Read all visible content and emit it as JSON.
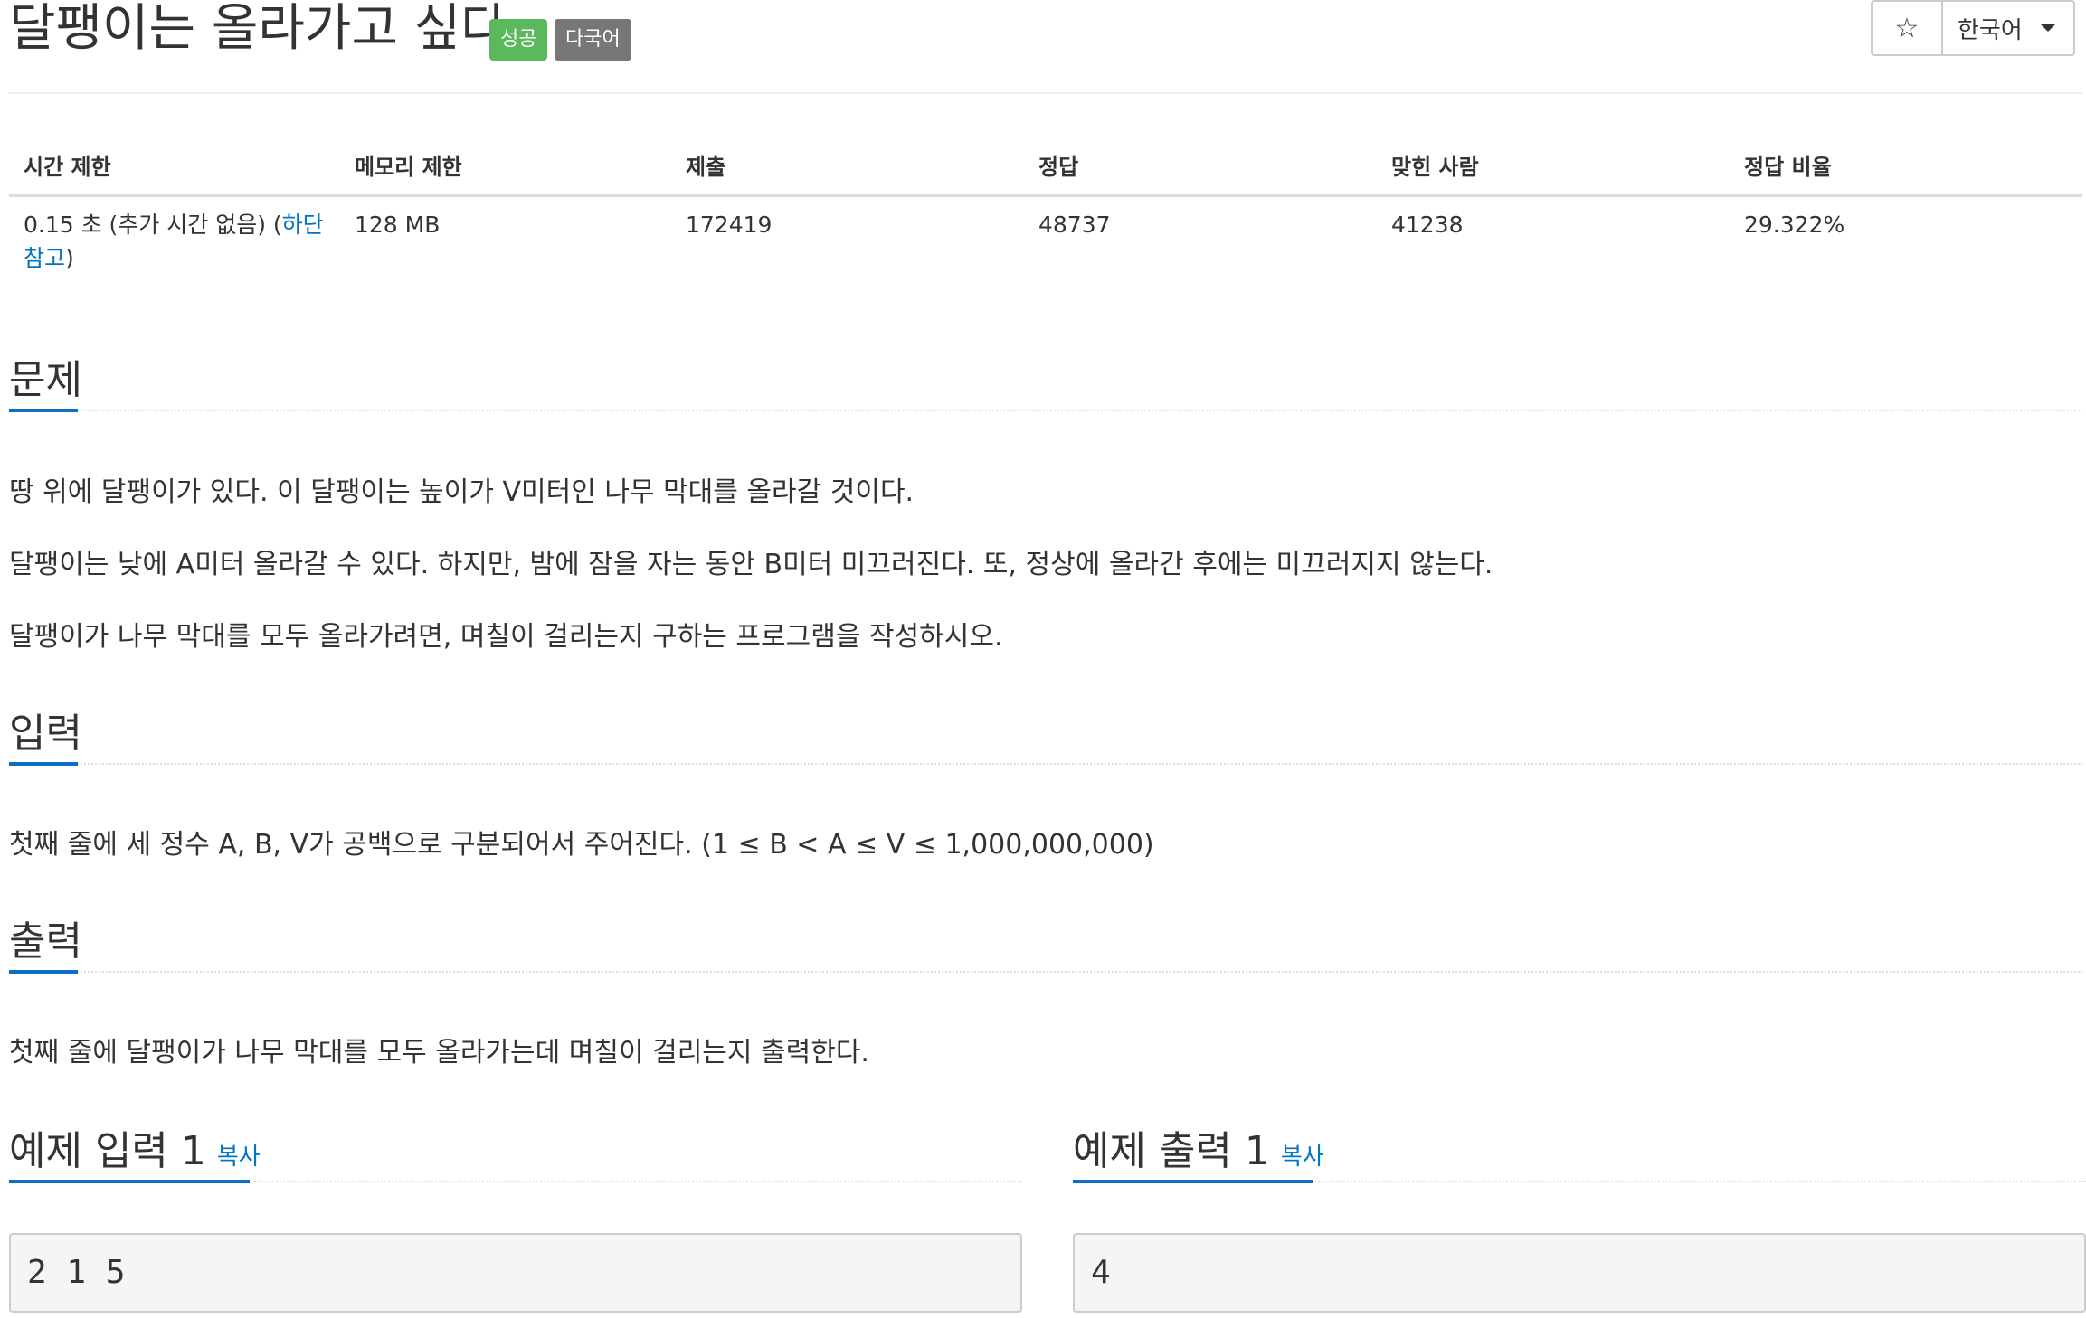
{
  "header": {
    "title": "달팽이는 올라가고 싶다",
    "success_label": "성공",
    "multilang_label": "다국어",
    "star_icon": "☆",
    "language": "한국어"
  },
  "info": {
    "headers": [
      "시간 제한",
      "메모리 제한",
      "제출",
      "정답",
      "맞힌 사람",
      "정답 비율"
    ],
    "time_limit": "0.15 초 (추가 시간 없음) (",
    "time_limit_link": "하단 참고",
    "time_limit_close": ")",
    "memory_limit": "128 MB",
    "submissions": "172419",
    "accepted": "48737",
    "solvers": "41238",
    "ratio": "29.322%"
  },
  "problem": {
    "heading": "문제",
    "lines": [
      "땅 위에 달팽이가 있다. 이 달팽이는 높이가 V미터인 나무 막대를 올라갈 것이다.",
      "달팽이는 낮에 A미터 올라갈 수 있다. 하지만, 밤에 잠을 자는 동안 B미터 미끄러진다. 또, 정상에 올라간 후에는 미끄러지지 않는다.",
      "달팽이가 나무 막대를 모두 올라가려면, 며칠이 걸리는지 구하는 프로그램을 작성하시오."
    ]
  },
  "input": {
    "heading": "입력",
    "text": "첫째 줄에 세 정수 A, B, V가 공백으로 구분되어서 주어진다. (1 ≤ B < A ≤ V ≤ 1,000,000,000)"
  },
  "output": {
    "heading": "출력",
    "text": "첫째 줄에 달팽이가 나무 막대를 모두 올라가는데 며칠이 걸리는지 출력한다."
  },
  "samples": {
    "input_heading": "예제 입력 1",
    "output_heading": "예제 출력 1",
    "copy_label": "복사",
    "input_value": "2 1 5",
    "output_value": "4"
  }
}
